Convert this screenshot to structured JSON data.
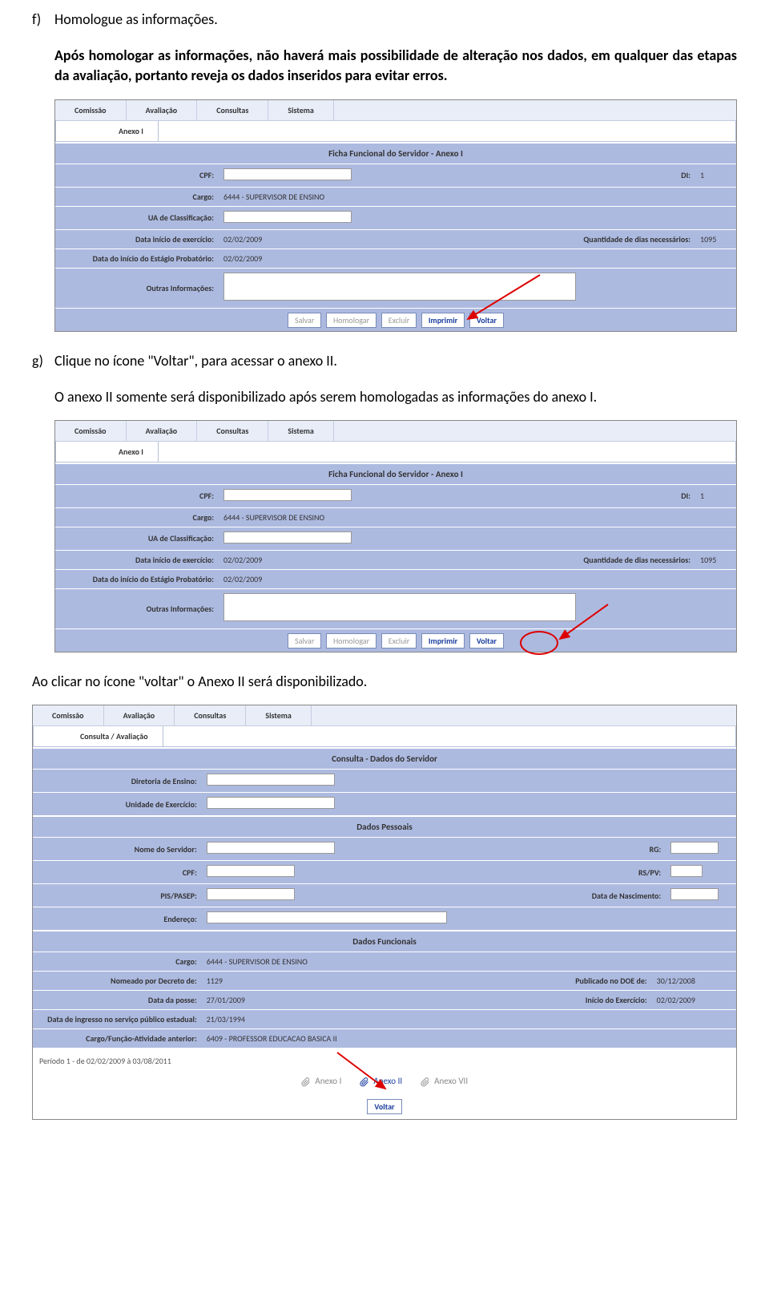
{
  "doc": {
    "f_label": "f)",
    "f_text": "Homologue as informações.",
    "f_para": "Após homologar as informações, não haverá mais possibilidade de alteração nos dados, em qualquer das etapas da avaliação, portanto reveja os dados inseridos para evitar erros.",
    "g_label": "g)",
    "g_text": "Clique no ícone \"Voltar\", para acessar o anexo II.",
    "g_para": "O anexo II somente será disponibilizado após serem homologadas as informações do anexo I.",
    "ao_clicar": "Ao clicar no ícone \"voltar\" o Anexo II será disponibilizado."
  },
  "shot1": {
    "menu": [
      "Comissão",
      "Avaliação",
      "Consultas",
      "Sistema"
    ],
    "subnav": "Anexo I",
    "header": "Ficha Funcional do Servidor - Anexo I",
    "labels": {
      "cpf": "CPF:",
      "di": "DI:",
      "di_val": "1",
      "cargo": "Cargo:",
      "cargo_val": "6444 - SUPERVISOR DE ENSINO",
      "ua": "UA de Classificação:",
      "data_inicio": "Data início de exercício:",
      "data_inicio_val": "02/02/2009",
      "qtd_dias": "Quantidade de dias necessários:",
      "qtd_dias_val": "1095",
      "data_estagio": "Data do início do Estágio Probatório:",
      "data_estagio_val": "02/02/2009",
      "outras": "Outras Informações:"
    },
    "buttons": {
      "salvar": "Salvar",
      "homologar": "Homologar",
      "excluir": "Excluir",
      "imprimir": "Imprimir",
      "voltar": "Voltar"
    }
  },
  "shot3": {
    "menu": [
      "Comissão",
      "Avaliação",
      "Consultas",
      "Sistema"
    ],
    "subnav": "Consulta / Avaliação",
    "header1": "Consulta - Dados do Servidor",
    "labels1": {
      "diretoria": "Diretoria de Ensino:",
      "unidade": "Unidade de Exercício:"
    },
    "header2": "Dados Pessoais",
    "labels2": {
      "nome": "Nome do Servidor:",
      "rg": "RG:",
      "cpf": "CPF:",
      "rspv": "RS/PV:",
      "pis": "PIS/PASEP:",
      "nasc": "Data de Nascimento:",
      "endereco": "Endereço:"
    },
    "header3": "Dados Funcionais",
    "labels3": {
      "cargo": "Cargo:",
      "cargo_val": "6444 - SUPERVISOR DE ENSINO",
      "nomeado": "Nomeado por Decreto de:",
      "nomeado_val": "1129",
      "publicado": "Publicado no DOE de:",
      "publicado_val": "30/12/2008",
      "posse": "Data da posse:",
      "posse_val": "27/01/2009",
      "inicio_ex": "Início do Exercício:",
      "inicio_ex_val": "02/02/2009",
      "ingresso": "Data de ingresso no serviço público estadual:",
      "ingresso_val": "21/03/1994",
      "cargo_ant": "Cargo/Função-Atividade anterior:",
      "cargo_ant_val": "6409 - PROFESSOR EDUCACAO BASICA II"
    },
    "periodo": "Período 1 - de 02/02/2009 à 03/08/2011",
    "anexos": {
      "a1": "Anexo I",
      "a2": "Anexo II",
      "a7": "Anexo VII"
    },
    "voltar": "Voltar"
  }
}
